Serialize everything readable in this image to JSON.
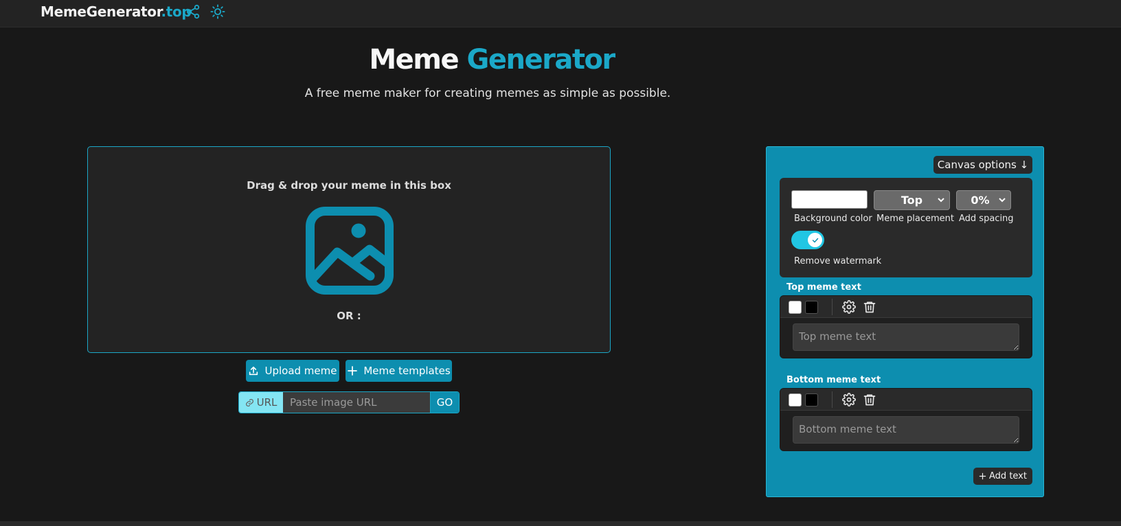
{
  "topbar": {
    "brand_main": "MemeGenerator",
    "brand_accent": ".top",
    "icons": [
      "share-icon",
      "sun-icon"
    ]
  },
  "hero": {
    "title_main": "Meme",
    "title_accent": "Generator",
    "subtitle": "A free meme maker for creating memes as simple as possible."
  },
  "dropzone": {
    "title": "Drag & drop your meme in this box",
    "icon": "image-icon",
    "or_text": "OR :"
  },
  "actions": {
    "upload_label": "Upload meme",
    "templates_label": "Meme templates"
  },
  "url_input": {
    "tag_label": "URL",
    "placeholder": "Paste image URL",
    "value": "",
    "go_label": "GO"
  },
  "panel": {
    "canvas_options_label": "Canvas options ↓",
    "options": {
      "background_color": "#ffffff",
      "background_color_label": "Background color",
      "placement_value": "Top",
      "placement_label": "Meme placement",
      "spacing_value": "0%",
      "spacing_label": "Add spacing",
      "watermark_toggle_on": true,
      "watermark_label": "Remove watermark"
    },
    "text_boxes": [
      {
        "title": "Top meme text",
        "placeholder": "Top meme text",
        "value": "",
        "fill_color": "#ffffff",
        "stroke_color": "#000000"
      },
      {
        "title": "Bottom meme text",
        "placeholder": "Bottom meme text",
        "value": "",
        "fill_color": "#ffffff",
        "stroke_color": "#000000"
      }
    ],
    "add_text_label": "Add text"
  },
  "colors": {
    "accent": "#1ba8c8",
    "panel_bg": "#0d8eaf",
    "page_bg": "#181818",
    "toggle_on": "#21c6e3"
  }
}
